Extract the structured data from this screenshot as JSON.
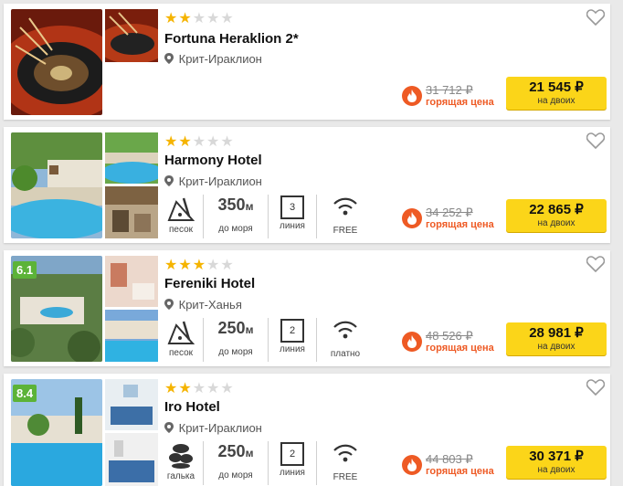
{
  "hotels": [
    {
      "name": "Fortuna Heraklion 2*",
      "stars": 2,
      "location": "Крит-Ираклион",
      "old_price": "31 712 ₽",
      "hot_label": "горящая цена",
      "price": "21 545 ₽",
      "price_sub": "на двоих"
    },
    {
      "name": "Harmony Hotel",
      "stars": 2,
      "location": "Крит-Ираклион",
      "beach_label": "песок",
      "distance": "350",
      "distance_unit": "м",
      "distance_label": "до моря",
      "line_value": "3",
      "line_label": "линия",
      "wifi_label": "FREE",
      "old_price": "34 252 ₽",
      "hot_label": "горящая цена",
      "price": "22 865 ₽",
      "price_sub": "на двоих"
    },
    {
      "name": "Fereniki Hotel",
      "rating": "6.1",
      "stars": 3,
      "location": "Крит-Ханья",
      "beach_label": "песок",
      "distance": "250",
      "distance_unit": "м",
      "distance_label": "до моря",
      "line_value": "2",
      "line_label": "линия",
      "wifi_label": "платно",
      "old_price": "48 526 ₽",
      "hot_label": "горящая цена",
      "price": "28 981 ₽",
      "price_sub": "на двоих"
    },
    {
      "name": "Iro Hotel",
      "rating": "8.4",
      "stars": 2,
      "location": "Крит-Ираклион",
      "beach_label": "галька",
      "distance": "250",
      "distance_unit": "м",
      "distance_label": "до моря",
      "line_value": "2",
      "line_label": "линия",
      "wifi_label": "FREE",
      "old_price": "44 803 ₽",
      "hot_label": "горящая цена",
      "price": "30 371 ₽",
      "price_sub": "на двоих"
    }
  ],
  "colors": {
    "accent": "#fbd519",
    "hot": "#ee5a24",
    "star": "#f5b400",
    "rating": "#5cb338"
  },
  "icons": [
    "heart-icon",
    "pin-icon",
    "sand-beach-icon",
    "pebble-beach-icon",
    "wifi-icon",
    "flame-icon"
  ]
}
